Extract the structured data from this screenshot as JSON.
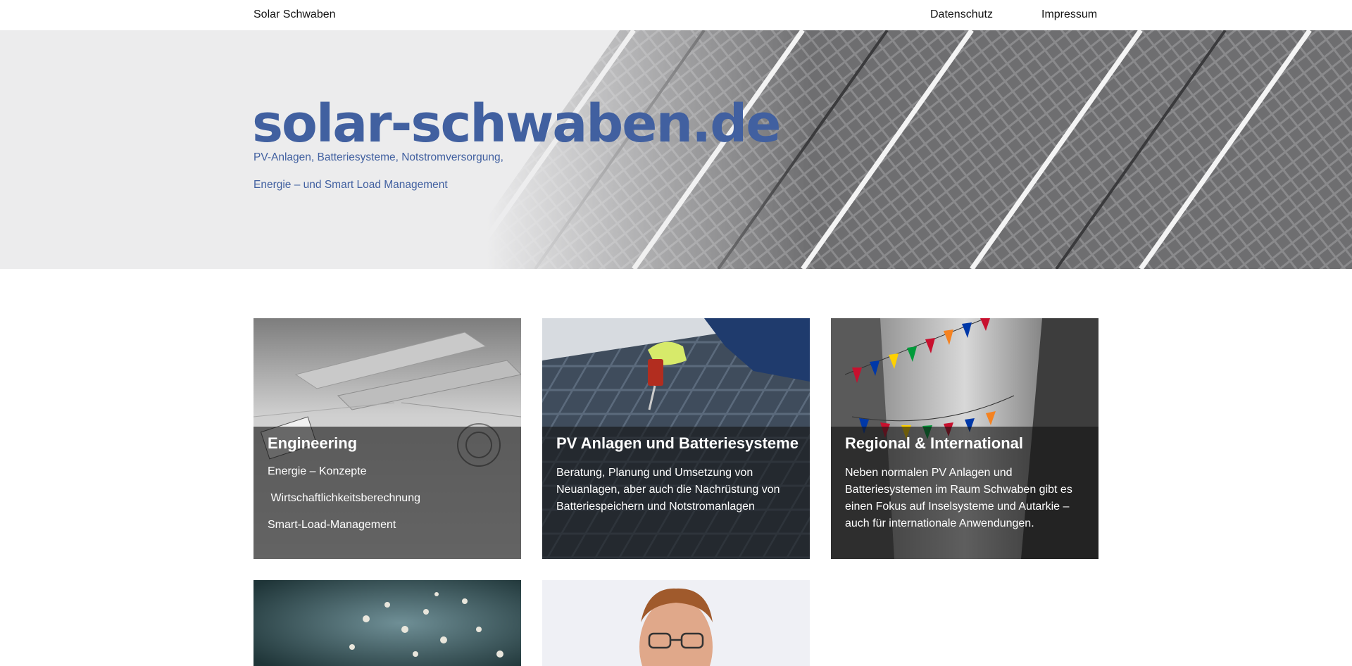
{
  "nav": {
    "brand": "Solar Schwaben",
    "links": [
      {
        "label": "Datenschutz"
      },
      {
        "label": "Impressum"
      }
    ]
  },
  "hero": {
    "title": "solar-schwaben.de",
    "subtitle_line1": "PV-Anlagen, Batteriesysteme, Notstromversorgung,",
    "subtitle_line2": "Energie – und Smart Load Management"
  },
  "cards": [
    {
      "title": "Engineering",
      "items": [
        "Energie – Konzepte",
        " Wirtschaftlichkeitsberechnung",
        "Smart-Load-Management"
      ]
    },
    {
      "title": "PV Anlagen und Batteriesysteme",
      "text": "Beratung, Planung und Umsetzung von Neuanlagen, aber auch die Nachrüstung von Batteriespeichern und Notstromanlagen"
    },
    {
      "title": "Regional & International",
      "text": "Neben normalen PV Anlagen und Batteriesystemen im Raum Schwaben gibt es einen Fokus auf Inselsysteme und Autarkie – auch für internationale Anwendungen."
    }
  ],
  "colors": {
    "accent": "#4160a0",
    "overlay": "#141414"
  }
}
